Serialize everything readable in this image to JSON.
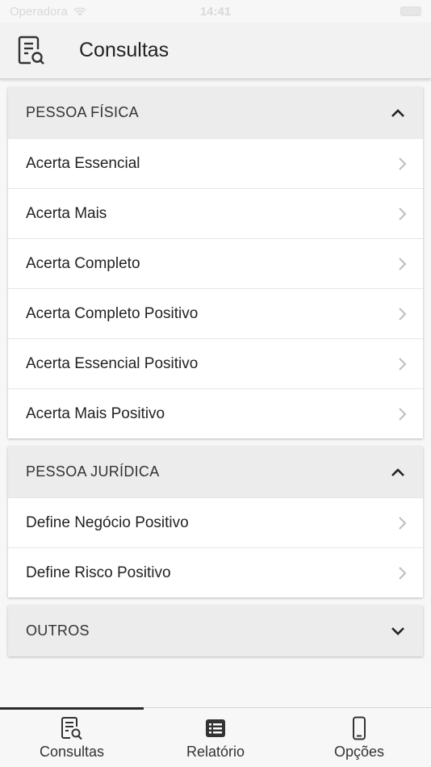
{
  "status_bar": {
    "carrier": "Operadora",
    "time": "14:41"
  },
  "header": {
    "title": "Consultas",
    "icon": "document-search-icon"
  },
  "sections": [
    {
      "title": "PESSOA FÍSICA",
      "expanded": true,
      "items": [
        {
          "label": "Acerta Essencial"
        },
        {
          "label": "Acerta Mais"
        },
        {
          "label": "Acerta Completo"
        },
        {
          "label": "Acerta Completo Positivo"
        },
        {
          "label": "Acerta Essencial Positivo"
        },
        {
          "label": "Acerta Mais Positivo"
        }
      ]
    },
    {
      "title": "PESSOA JURÍDICA",
      "expanded": true,
      "items": [
        {
          "label": "Define Negócio Positivo"
        },
        {
          "label": "Define Risco Positivo"
        }
      ]
    },
    {
      "title": "OUTROS",
      "expanded": false,
      "items": []
    }
  ],
  "tabs": [
    {
      "label": "Consultas",
      "icon": "document-search-icon",
      "active": true
    },
    {
      "label": "Relatório",
      "icon": "list-icon",
      "active": false
    },
    {
      "label": "Opções",
      "icon": "phone-icon",
      "active": false
    }
  ],
  "colors": {
    "header_bg": "#f2f2f2",
    "section_header_bg": "#ececec",
    "active_tab_indicator": "#2a2a2a"
  }
}
